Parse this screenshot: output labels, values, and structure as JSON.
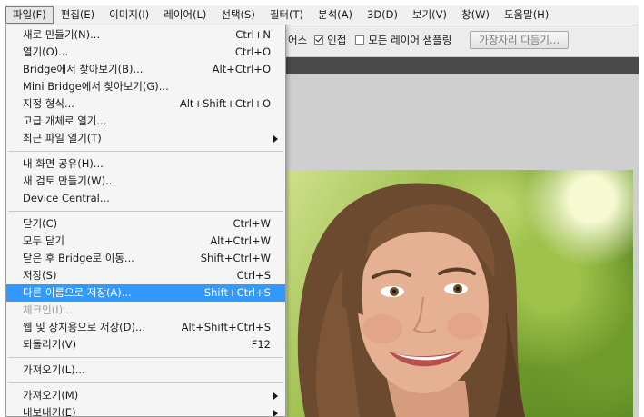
{
  "menubar": {
    "items": [
      "파일(F)",
      "편집(E)",
      "이미지(I)",
      "레이어(L)",
      "선택(S)",
      "필터(T)",
      "분석(A)",
      "3D(D)",
      "보기(V)",
      "창(W)",
      "도움말(H)"
    ]
  },
  "options": {
    "partial_label": "어스",
    "contiguous_label": "인접",
    "sample_all_label": "모든 레이어 샘플링",
    "refine_button": "가장자리 다듬기..."
  },
  "filemenu": {
    "group1": [
      {
        "label": "새로 만들기(N)...",
        "shortcut": "Ctrl+N"
      },
      {
        "label": "열기(O)...",
        "shortcut": "Ctrl+O"
      },
      {
        "label": "Bridge에서 찾아보기(B)...",
        "shortcut": "Alt+Ctrl+O"
      },
      {
        "label": "Mini Bridge에서 찾아보기(G)...",
        "shortcut": ""
      },
      {
        "label": "지정 형식...",
        "shortcut": "Alt+Shift+Ctrl+O"
      },
      {
        "label": "고급 개체로 열기...",
        "shortcut": ""
      },
      {
        "label": "최근 파일 열기(T)",
        "shortcut": ""
      }
    ],
    "group2": [
      {
        "label": "내 화면 공유(H)...",
        "shortcut": ""
      },
      {
        "label": "새 검토 만들기(W)...",
        "shortcut": ""
      },
      {
        "label": "Device Central...",
        "shortcut": ""
      }
    ],
    "group3": [
      {
        "label": "닫기(C)",
        "shortcut": "Ctrl+W"
      },
      {
        "label": "모두 닫기",
        "shortcut": "Alt+Ctrl+W"
      },
      {
        "label": "닫은 후 Bridge로 이동...",
        "shortcut": "Shift+Ctrl+W"
      },
      {
        "label": "저장(S)",
        "shortcut": "Ctrl+S"
      },
      {
        "label": "다른 이름으로 저장(A)...",
        "shortcut": "Shift+Ctrl+S"
      },
      {
        "label": "체크인(I)...",
        "shortcut": ""
      },
      {
        "label": "웹 및 장치용으로 저장(D)...",
        "shortcut": "Alt+Shift+Ctrl+S"
      },
      {
        "label": "되돌리기(V)",
        "shortcut": "F12"
      }
    ],
    "group4": [
      {
        "label": "가져오기(L)...",
        "shortcut": ""
      }
    ],
    "group5": [
      {
        "label": "가져오기(M)",
        "shortcut": ""
      },
      {
        "label": "내보내기(E)",
        "shortcut": ""
      }
    ]
  },
  "colors": {
    "highlight": "#3399ff",
    "menu_bg": "#f5f5f5",
    "workspace": "#cfcfcf"
  }
}
